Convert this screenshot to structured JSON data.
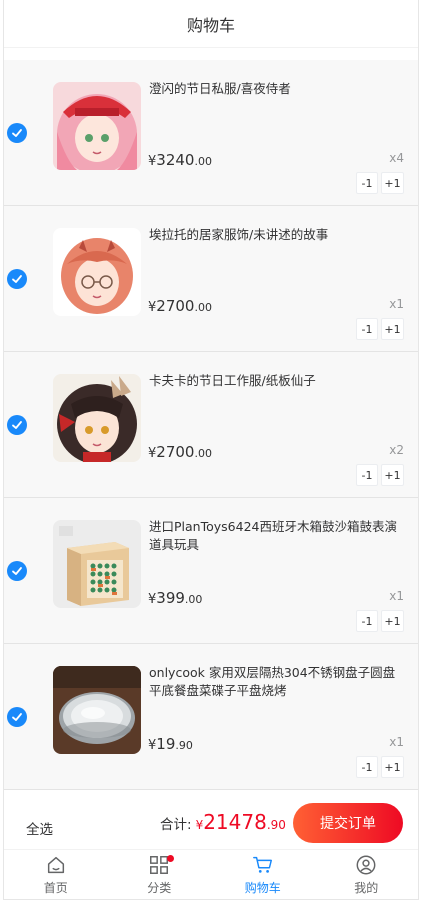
{
  "navbar": {
    "title": "购物车"
  },
  "cart": {
    "items": [
      {
        "title": "澄闪的节日私服/喜夜侍者",
        "currency": "¥",
        "price_int": "3240",
        "price_dec": ".00",
        "qty": "x4",
        "minus": "-1",
        "plus": "+1",
        "thumb": "anime-pink-hair-red-cap"
      },
      {
        "title": "埃拉托的居家服饰/未讲述的故事",
        "currency": "¥",
        "price_int": "2700",
        "price_dec": ".00",
        "qty": "x1",
        "minus": "-1",
        "plus": "+1",
        "thumb": "anime-orange-hair-glasses"
      },
      {
        "title": "卡夫卡的节日工作服/纸板仙子",
        "currency": "¥",
        "price_int": "2700",
        "price_dec": ".00",
        "qty": "x2",
        "minus": "-1",
        "plus": "+1",
        "thumb": "anime-dark-hair-red-bow"
      },
      {
        "title": "进口PlanToys6424西班牙木箱鼓沙箱鼓表演道具玩具",
        "currency": "¥",
        "price_int": "399",
        "price_dec": ".00",
        "qty": "x1",
        "minus": "-1",
        "plus": "+1",
        "thumb": "wooden-cajon-box"
      },
      {
        "title": "onlycook 家用双层隔热304不锈钢盘子圆盘平底餐盘菜碟子平盘烧烤",
        "currency": "¥",
        "price_int": "19",
        "price_dec": ".90",
        "qty": "x1",
        "minus": "-1",
        "plus": "+1",
        "thumb": "steel-plates"
      }
    ]
  },
  "submit_bar": {
    "select_all": "全选",
    "total_label": "合计:",
    "currency": "¥",
    "total_int": "21478",
    "total_dec": ".90",
    "submit_label": "提交订单"
  },
  "tabbar": {
    "tabs": [
      {
        "label": "首页",
        "icon": "home-icon"
      },
      {
        "label": "分类",
        "icon": "category-icon"
      },
      {
        "label": "购物车",
        "icon": "cart-icon",
        "active": true
      },
      {
        "label": "我的",
        "icon": "user-icon"
      }
    ]
  },
  "colors": {
    "primary": "#1989fa",
    "danger": "#ee0a24",
    "gradient_start": "#ff6034"
  }
}
